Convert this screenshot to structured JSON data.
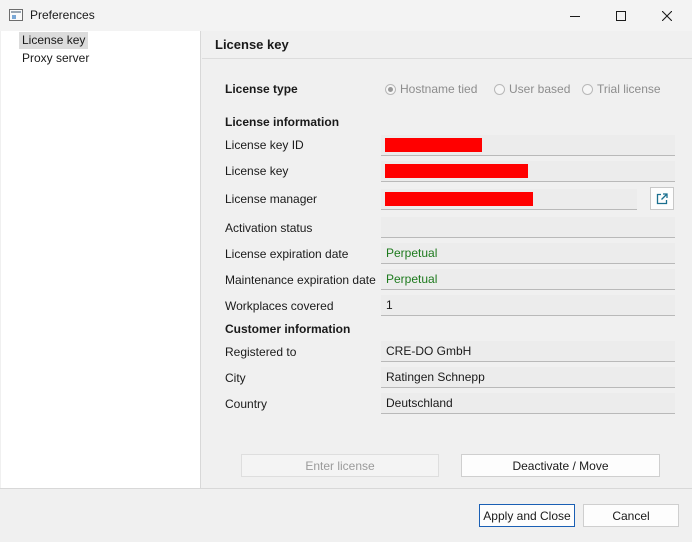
{
  "window": {
    "title": "Preferences"
  },
  "tree": {
    "items": [
      {
        "label": "License key",
        "selected": true
      },
      {
        "label": "Proxy server",
        "selected": false
      }
    ]
  },
  "panel": {
    "title": "License key",
    "license_type": {
      "label": "License type",
      "options": [
        {
          "label": "Hostname tied",
          "selected": true
        },
        {
          "label": "User based",
          "selected": false
        },
        {
          "label": "Trial license",
          "selected": false
        }
      ]
    },
    "license_information": {
      "heading": "License information",
      "key_id_label": "License key ID",
      "key_label": "License key",
      "manager_label": "License manager",
      "activation_label": "Activation status",
      "activation_value": "",
      "expiration_label": "License expiration date",
      "expiration_value": "Perpetual",
      "maintenance_label": "Maintenance expiration date",
      "maintenance_value": "Perpetual",
      "workplaces_label": "Workplaces covered",
      "workplaces_value": "1"
    },
    "customer_information": {
      "heading": "Customer information",
      "registered_label": "Registered to",
      "registered_value": "CRE-DO GmbH",
      "city_label": "City",
      "city_value": "Ratingen Schnepp",
      "country_label": "Country",
      "country_value": "Deutschland"
    },
    "buttons": {
      "enter_license": "Enter license",
      "deactivate": "Deactivate / Move"
    }
  },
  "footer": {
    "apply_close": "Apply and Close",
    "cancel": "Cancel"
  },
  "colors": {
    "redaction": "#ff0000",
    "value_green": "#1d7a1d",
    "accent": "#1a5fb4"
  }
}
